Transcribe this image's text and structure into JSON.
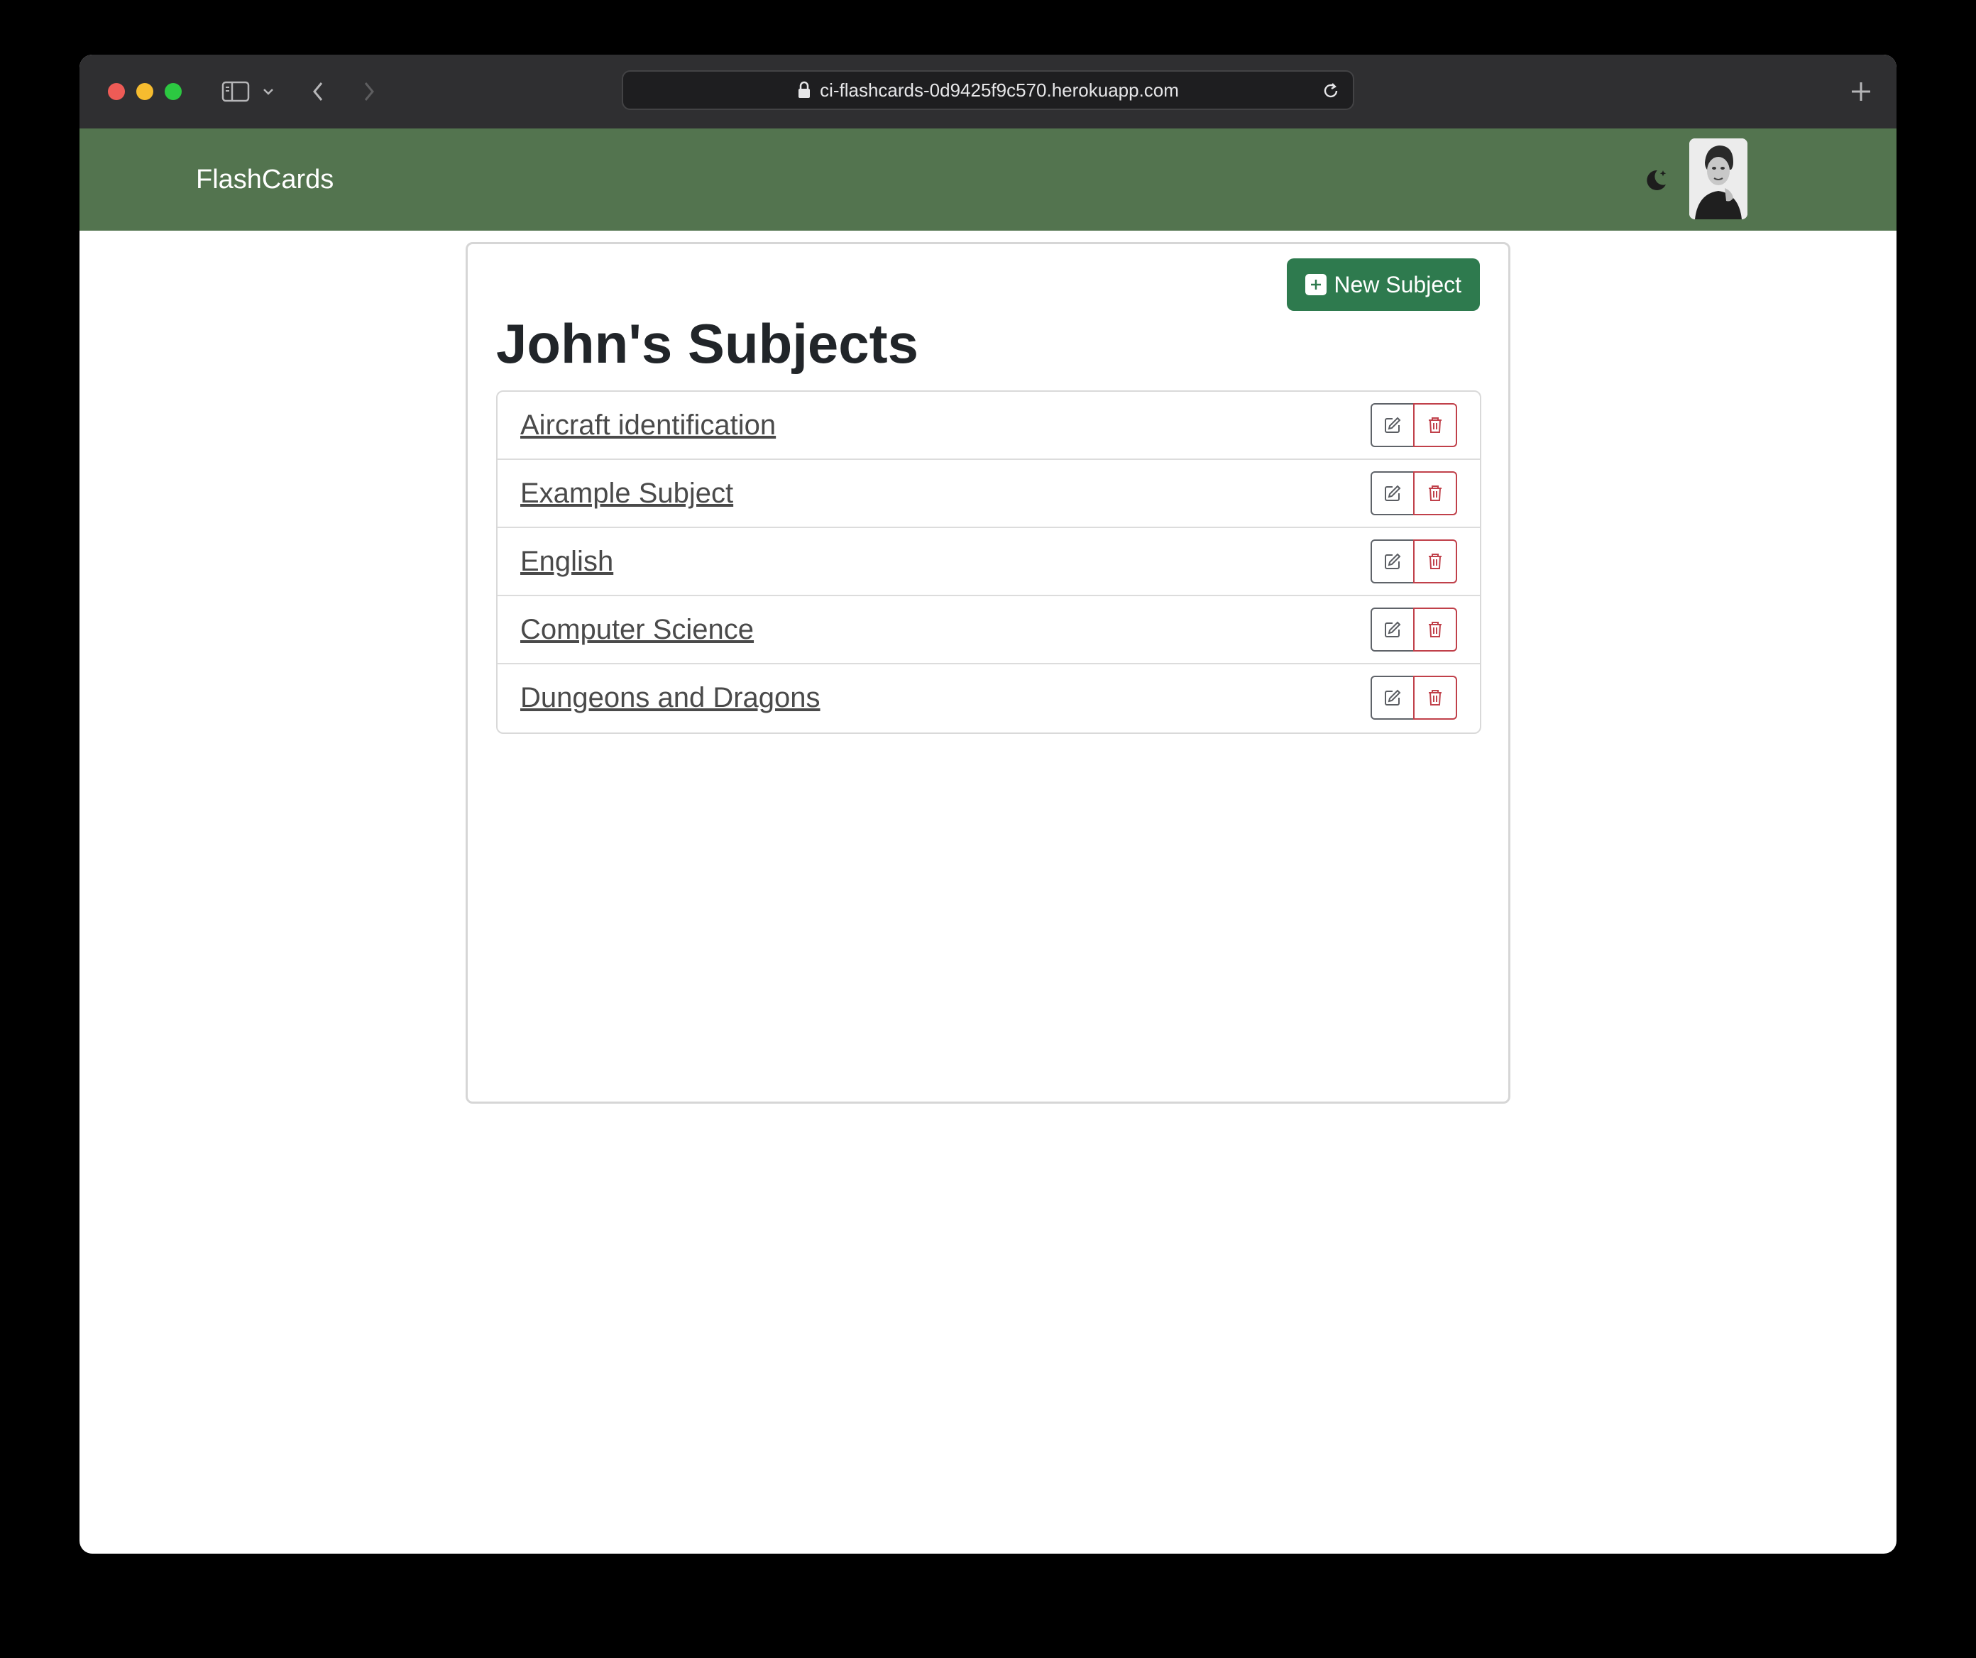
{
  "browser": {
    "url": "ci-flashcards-0d9425f9c570.herokuapp.com"
  },
  "navbar": {
    "brand": "FlashCards",
    "theme_toggle_icon": "moon-stars-icon",
    "avatar_icon": "user-avatar-photo"
  },
  "main": {
    "new_subject_label": "New Subject",
    "title": "John's Subjects",
    "subjects": [
      {
        "name": "Aircraft identification"
      },
      {
        "name": "Example Subject"
      },
      {
        "name": "English"
      },
      {
        "name": "Computer Science"
      },
      {
        "name": "Dungeons and Dragons"
      }
    ]
  },
  "colors": {
    "navbar_bg": "#53744f",
    "primary_button": "#2e7a4e",
    "delete_accent": "#c0404a"
  }
}
